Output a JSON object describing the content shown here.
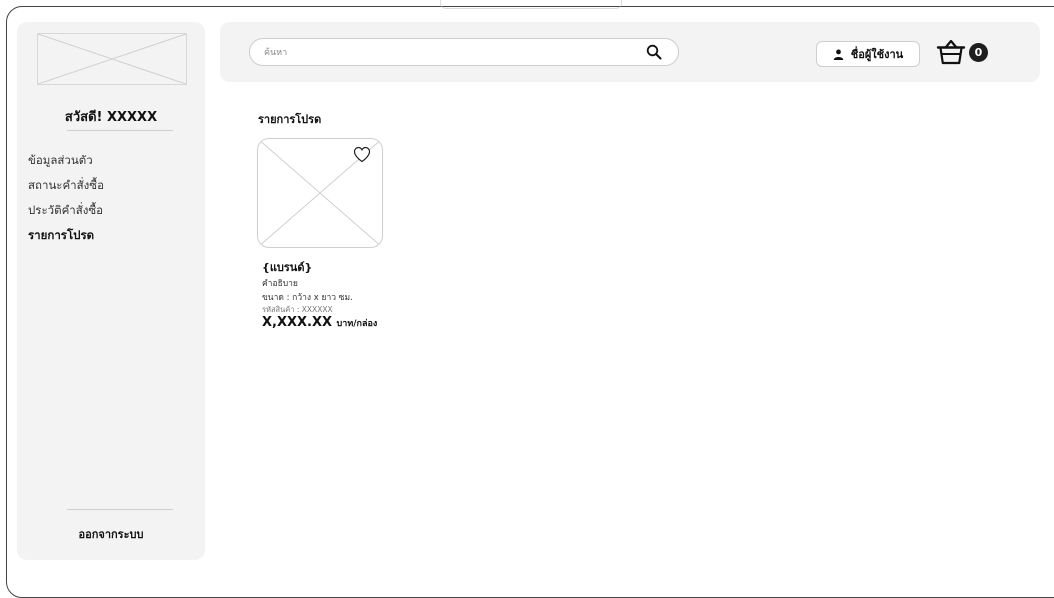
{
  "sidebar": {
    "greeting": "สวัสดี! XXXXX",
    "menu": [
      {
        "label": "ข้อมูลส่วนตัว"
      },
      {
        "label": "สถานะคำสั่งซื้อ"
      },
      {
        "label": "ประวัติคำสั่งซื้อ"
      },
      {
        "label": "รายการโปรด"
      }
    ],
    "logout_label": "ออกจากระบบ"
  },
  "header": {
    "search_placeholder": "ค้นหา",
    "user_label": "ชื่อผู้ใช้งาน",
    "cart_count": "0"
  },
  "main": {
    "section_title": "รายการโปรด",
    "product": {
      "brand": "{แบรนด์}",
      "description": "คำอธิบาย",
      "size": "ขนาด : กว้าง x ยาว ซม.",
      "code": "รหัสสินค้า : XXXXXX",
      "price": "X,XXX.XX",
      "price_unit": "บาท/กล่อง"
    }
  },
  "icons": {
    "search": "search-icon",
    "user": "user-icon",
    "cart": "basket-icon",
    "favorite": "heart-icon"
  },
  "colors": {
    "panel_bg": "#f3f3f3",
    "badge_bg": "#1e1e1e"
  }
}
